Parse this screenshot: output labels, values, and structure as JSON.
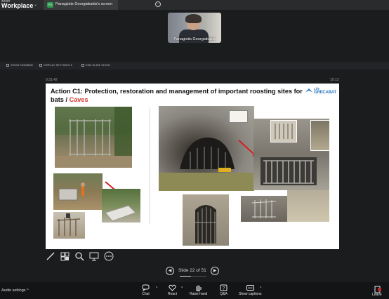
{
  "app": {
    "top_small": "zoom",
    "name": "Workplace"
  },
  "share_tab": {
    "icon_text": "PG",
    "label": "Panagiotis Georgiakakis's screen"
  },
  "participant": {
    "name": "Panagiotis Georgiakakis"
  },
  "share_toolbar": [
    {
      "icon": "monitor-icon",
      "label": "SHOW TASKBAR"
    },
    {
      "icon": "settings-icon",
      "label": "DISPLAY SETTINGS ▾"
    },
    {
      "icon": "slideshow-icon",
      "label": "END SLIDE SHOW"
    }
  ],
  "presenter": {
    "elapsed": "0:31:42",
    "clock": "10:13"
  },
  "slide": {
    "title_main": "Action C1: Protection, restoration and management of important roosting sites for bats / ",
    "title_accent": "Caves",
    "logo_line1": "Life",
    "logo_line2": "GRECABAT"
  },
  "slide_nav": {
    "label": "Slide 22 of 51",
    "current": 22,
    "total": 51
  },
  "presenter_tools": [
    "pen-icon",
    "all-slides-icon",
    "zoom-icon",
    "monitor-icon",
    "more-icon"
  ],
  "audio": {
    "label": "Audio settings"
  },
  "controls": [
    {
      "icon": "chat-icon",
      "label": "Chat"
    },
    {
      "icon": "heart-icon",
      "label": "React"
    },
    {
      "icon": "raise-hand-icon",
      "label": "Raise hand"
    },
    {
      "icon": "qa-icon",
      "label": "Q&A"
    },
    {
      "icon": "captions-icon",
      "label": "Show captions"
    }
  ],
  "leave": {
    "label": "Leave"
  },
  "colors": {
    "accent_red": "#d63a2b",
    "logo_blue": "#2f78c2",
    "leave_red": "#c0272d"
  }
}
